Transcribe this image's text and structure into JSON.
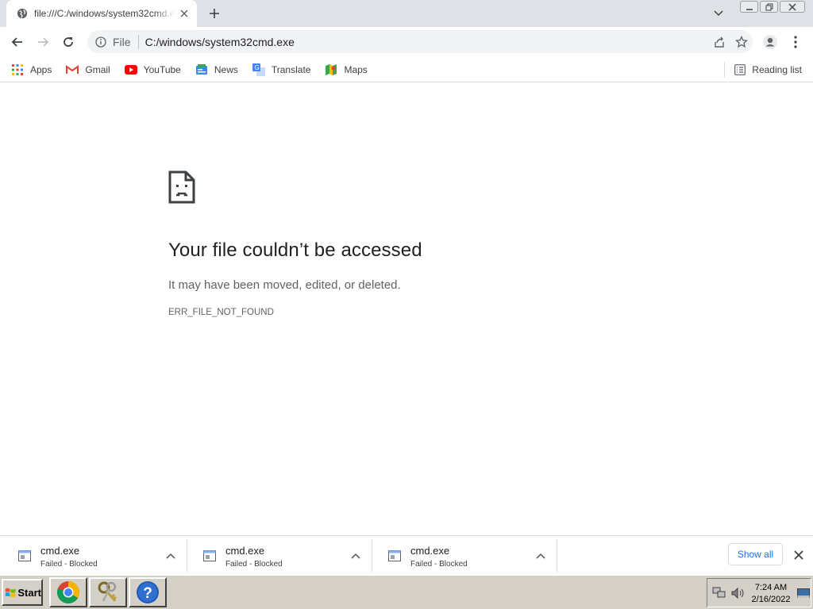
{
  "browser": {
    "tab": {
      "title": "file:///C:/windows/system32cmd.exe",
      "favicon": "globe-icon"
    },
    "omnibox": {
      "scheme_label": "File",
      "url": "C:/windows/system32cmd.exe"
    },
    "bookmarks": [
      {
        "label": "Apps",
        "icon": "apps-grid-icon"
      },
      {
        "label": "Gmail",
        "icon": "gmail-icon"
      },
      {
        "label": "YouTube",
        "icon": "youtube-icon"
      },
      {
        "label": "News",
        "icon": "news-icon"
      },
      {
        "label": "Translate",
        "icon": "translate-icon"
      },
      {
        "label": "Maps",
        "icon": "maps-icon"
      }
    ],
    "reading_list": "Reading list"
  },
  "error": {
    "title": "Your file couldn’t be accessed",
    "message": "It may have been moved, edited, or deleted.",
    "code": "ERR_FILE_NOT_FOUND"
  },
  "downloads": {
    "items": [
      {
        "name": "cmd.exe",
        "status": "Failed - Blocked"
      },
      {
        "name": "cmd.exe",
        "status": "Failed - Blocked"
      },
      {
        "name": "cmd.exe",
        "status": "Failed - Blocked"
      }
    ],
    "show_all": "Show all"
  },
  "taskbar": {
    "start_label": "Start",
    "apps": [
      "chrome-icon",
      "keys-icon",
      "help-icon"
    ],
    "clock": {
      "time": "7:24 AM",
      "date": "2/16/2022"
    }
  },
  "colors": {
    "accent": "#1a73e8",
    "tabstrip": "#dee1e6",
    "taskbar": "#d4d0c8"
  }
}
